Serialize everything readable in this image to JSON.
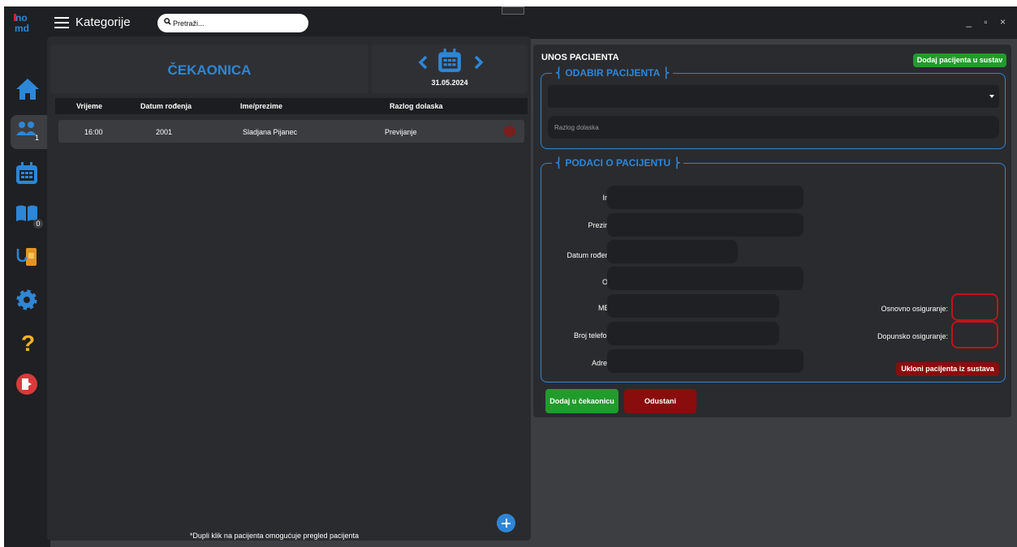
{
  "app": {
    "logo_text": "ino md"
  },
  "titlebar": {
    "menu_label": "Kategorije",
    "search_placeholder": "Pretraži...",
    "window_controls": "_ ▫ ×"
  },
  "sidebar": {
    "items": [
      {
        "icon": "home-icon"
      },
      {
        "icon": "patients-icon",
        "badge": "1"
      },
      {
        "icon": "calendar-icon"
      },
      {
        "icon": "book-icon",
        "badge": "0"
      },
      {
        "icon": "medical-device-icon"
      },
      {
        "icon": "gear-icon"
      },
      {
        "icon": "help-icon"
      },
      {
        "icon": "logout-icon"
      }
    ]
  },
  "waiting_room": {
    "title": "ČEKAONICA",
    "date": "31.05.2024",
    "columns": [
      "Vrijeme",
      "Datum rođenja",
      "Ime/prezime",
      "Razlog dolaska"
    ],
    "rows": [
      {
        "time": "16:00",
        "birth": "2001",
        "name": "Sladjana Pijanec",
        "reason": "Previjanje"
      }
    ],
    "hint": "*Dupli klik na pacijenta omogućuje pregled pacijenta"
  },
  "patient_entry": {
    "title": "UNOS PACIJENTA",
    "add_system_button": "Dodaj pacijenta u sustav",
    "select_section": {
      "legend": "ODABIR PACIJENTA",
      "patient_select_value": "",
      "reason_placeholder": "Razlog dolaska"
    },
    "data_section": {
      "legend": "PODACI O PACIJENTU",
      "labels": {
        "first_name": "Ime:",
        "last_name": "Prezime:",
        "birth_date": "Datum rođenja:",
        "oib": "OIB:",
        "mbo": "MBO:",
        "phone": "Broj telefona:",
        "address": "Adresa:",
        "basic_insurance": "Osnovno osiguranje:",
        "supplementary_insurance": "Dopunsko osiguranje:"
      },
      "remove_button": "Ukloni pacijenta iz sustava"
    },
    "add_waiting_button": "Dodaj u čekaonicu",
    "cancel_button": "Odustani"
  },
  "colors": {
    "accent": "#2e86d6",
    "green": "#219b2c",
    "red": "#8a0d0d",
    "sidebar": "#1f2023"
  }
}
